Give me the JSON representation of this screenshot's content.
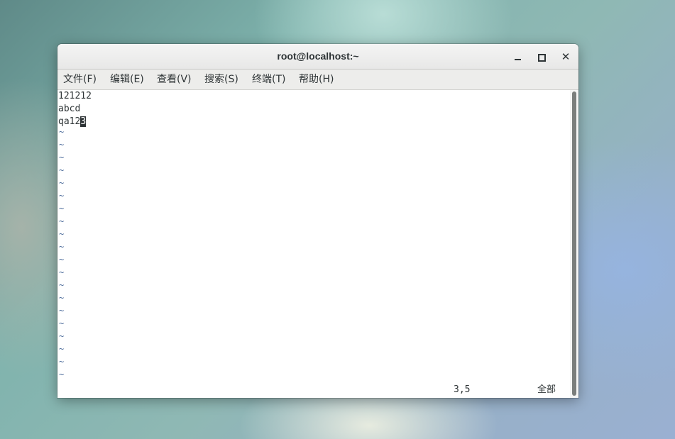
{
  "window": {
    "title": "root@localhost:~"
  },
  "menu": [
    {
      "label": "文件(F)"
    },
    {
      "label": "编辑(E)"
    },
    {
      "label": "查看(V)"
    },
    {
      "label": "搜索(S)"
    },
    {
      "label": "终端(T)"
    },
    {
      "label": "帮助(H)"
    }
  ],
  "editor": {
    "lines": [
      "121212",
      "abcd",
      "qa12"
    ],
    "cursor_char": "3",
    "empty_line_marker": "~",
    "status_position": "3,5",
    "status_scope": "全部"
  },
  "icons": {
    "minimize": "minimize-icon",
    "maximize": "maximize-icon",
    "close": "close-icon"
  }
}
